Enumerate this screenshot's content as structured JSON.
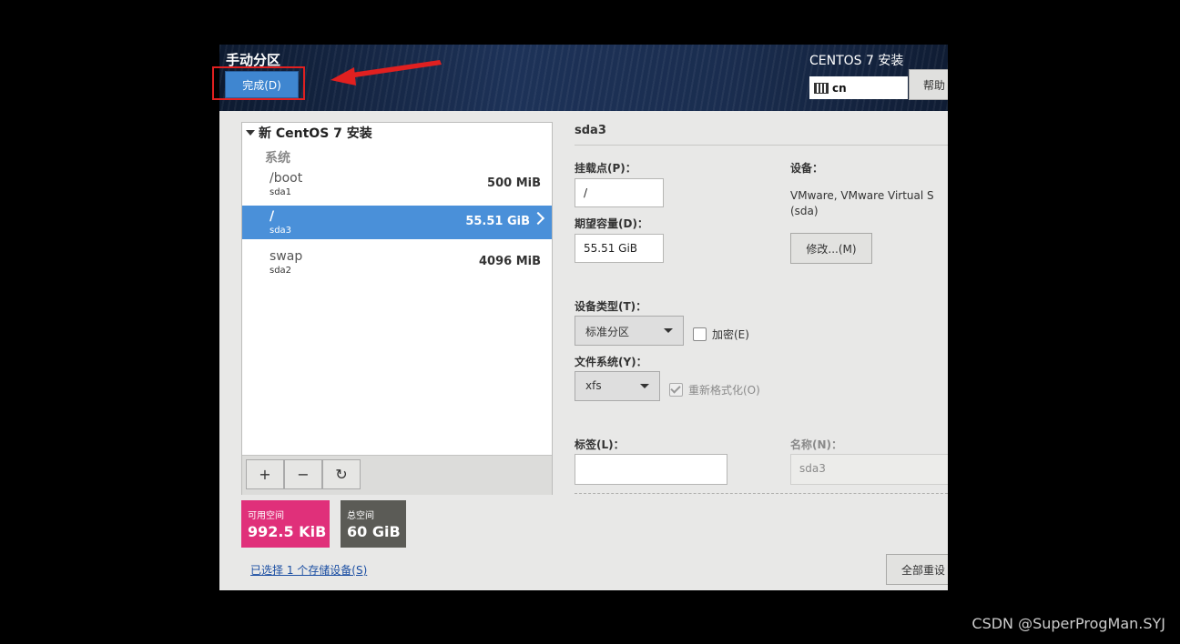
{
  "header": {
    "title": "手动分区",
    "done_label": "完成(D)",
    "app_title": "CENTOS 7 安装",
    "keyboard_layout": "cn",
    "help_label": "帮助"
  },
  "tree": {
    "root_label": "新 CentOS 7 安装",
    "group_label": "系统",
    "rows": [
      {
        "name": "/boot",
        "device": "sda1",
        "size": "500 MiB"
      },
      {
        "name": "/",
        "device": "sda3",
        "size": "55.51 GiB",
        "selected": true
      },
      {
        "name": "swap",
        "device": "sda2",
        "size": "4096 MiB"
      }
    ],
    "toolbar": {
      "add": "+",
      "remove": "−",
      "refresh": "↻"
    }
  },
  "space": {
    "available_label": "可用空间",
    "available_value": "992.5 KiB",
    "available_color": "#e0307a",
    "total_label": "总空间",
    "total_value": "60 GiB",
    "total_color": "#5b5b56"
  },
  "storage_link": "已选择 1 个存储设备(S)",
  "detail": {
    "device_title": "sda3",
    "mount_label": "挂载点(P)：",
    "mount_value": "/",
    "capacity_label": "期望容量(D)：",
    "capacity_value": "55.51 GiB",
    "devices_label": "设备：",
    "devices_text_1": "VMware, VMware Virtual S",
    "devices_text_2": "(sda)",
    "modify_label": "修改...(M)",
    "device_type_label": "设备类型(T)：",
    "device_type_value": "标准分区",
    "encrypt_label": "加密(E)",
    "filesystem_label": "文件系统(Y)：",
    "filesystem_value": "xfs",
    "reformat_label": "重新格式化(O)",
    "tag_label": "标签(L)：",
    "tag_value": "",
    "name_label": "名称(N)：",
    "name_value": "sda3",
    "reset_label": "全部重设"
  },
  "watermark": "CSDN @SuperProgMan.SYJ"
}
